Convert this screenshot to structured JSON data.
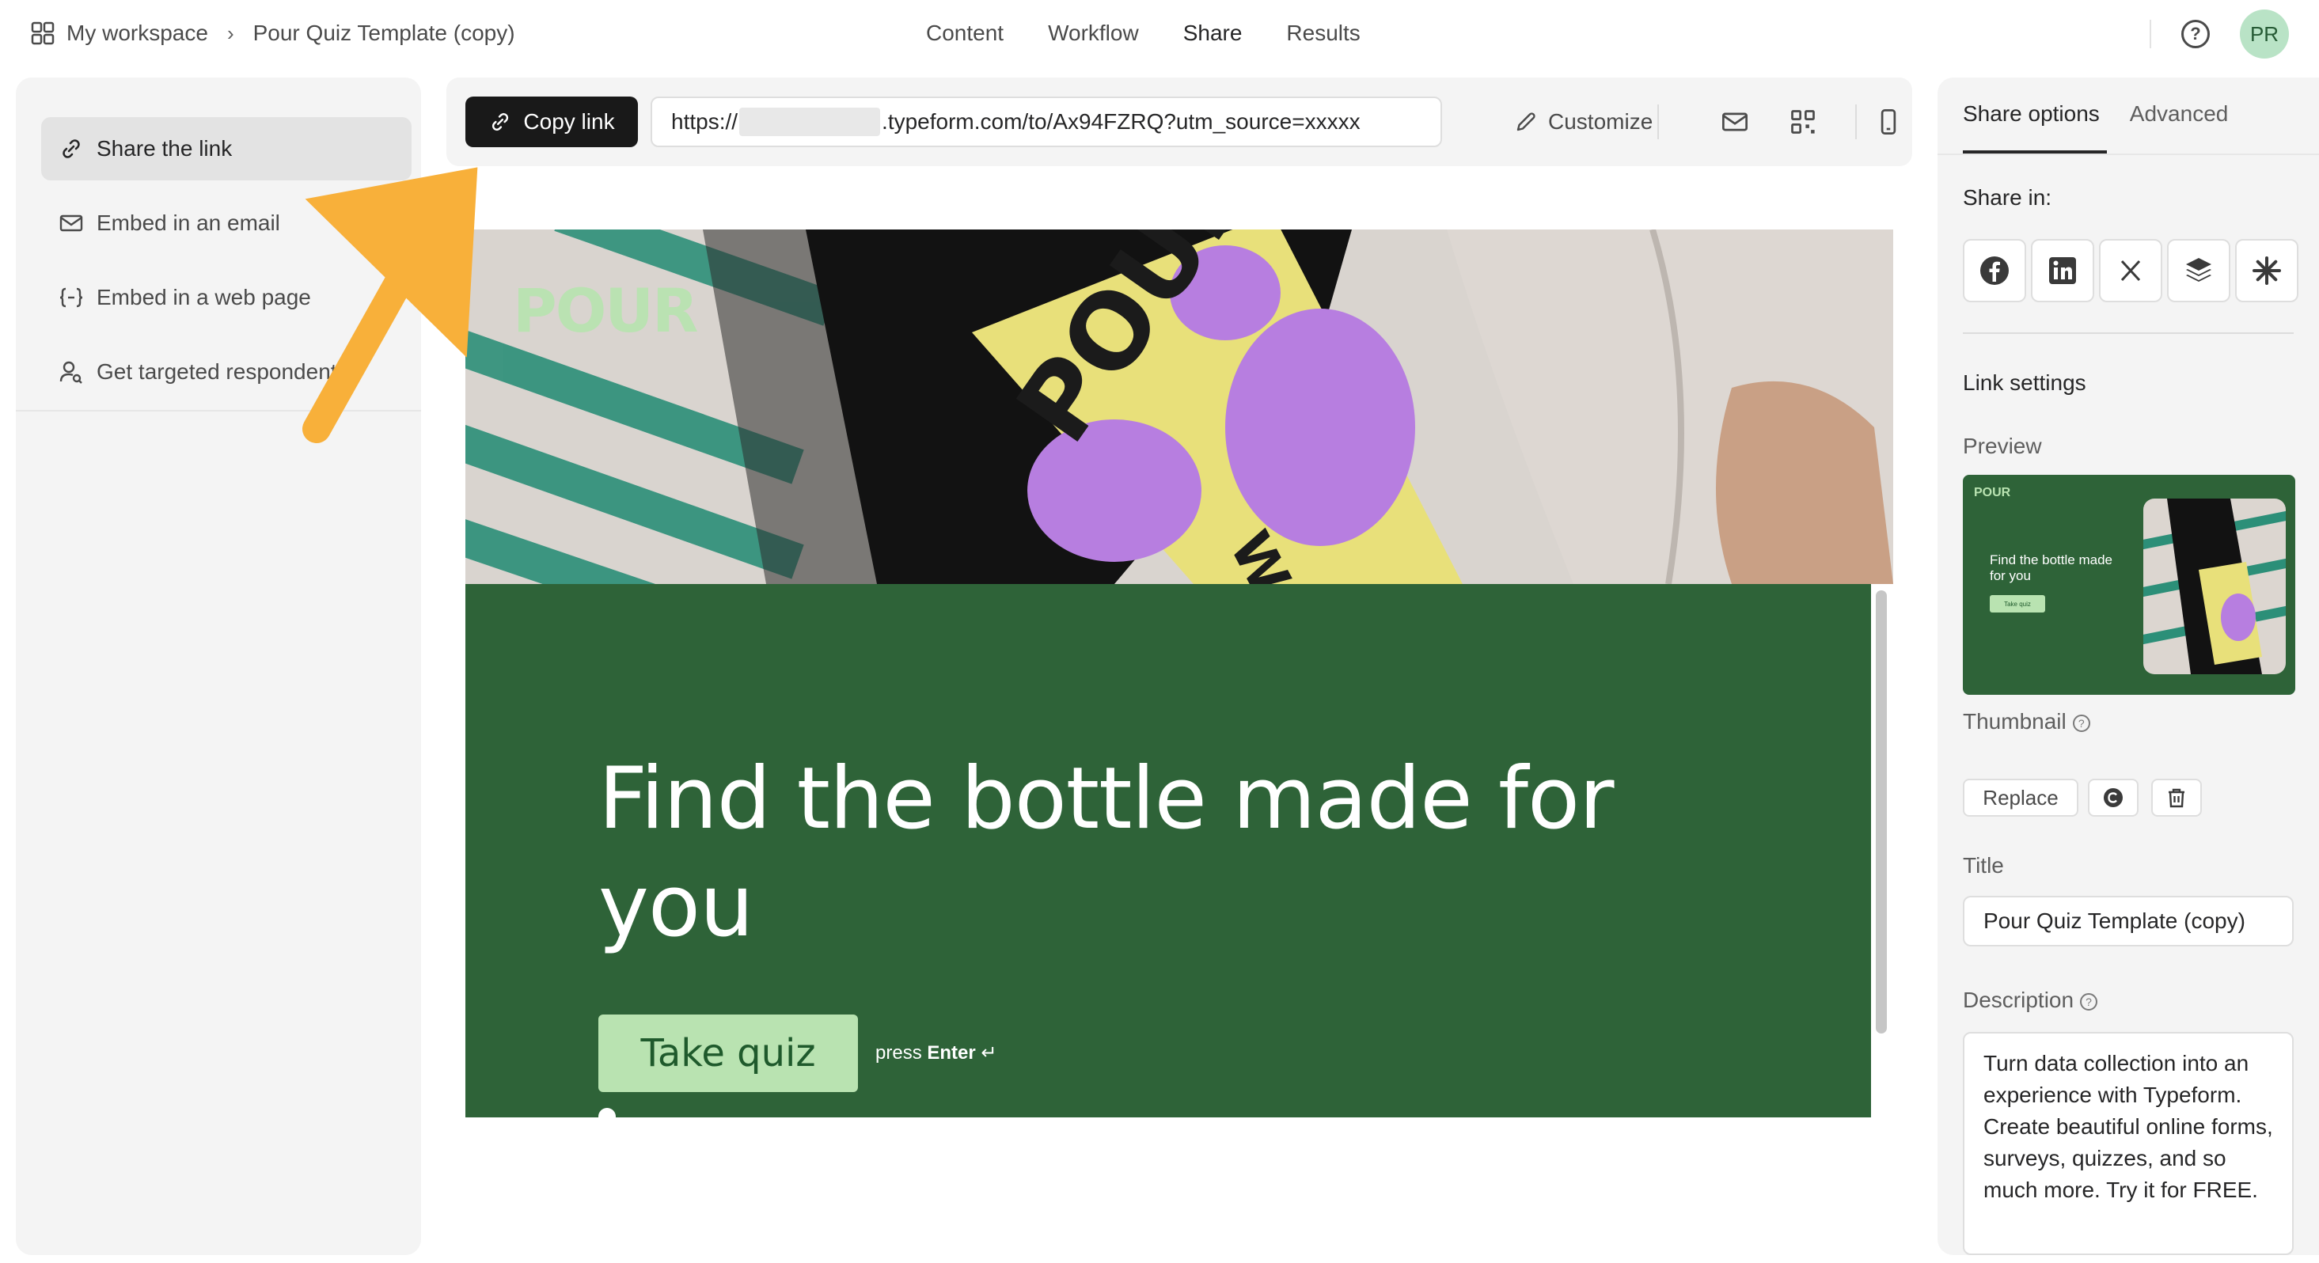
{
  "breadcrumb": {
    "workspace": "My workspace",
    "separator": "›",
    "form_name": "Pour Quiz Template (copy)"
  },
  "nav": {
    "tabs": [
      "Content",
      "Workflow",
      "Share",
      "Results"
    ],
    "active": "Share"
  },
  "user": {
    "initials": "PR"
  },
  "sidebar": {
    "items": [
      {
        "label": "Share the link",
        "icon": "link-icon",
        "active": true
      },
      {
        "label": "Embed in an email",
        "icon": "mail-icon",
        "active": false
      },
      {
        "label": "Embed in a web page",
        "icon": "embed-code-icon",
        "active": false
      },
      {
        "label": "Get targeted respondents",
        "icon": "person-search-icon",
        "active": false
      }
    ]
  },
  "toolbar": {
    "copy_label": "Copy link",
    "url_prefix": "https://",
    "url_suffix": ".typeform.com/to/Ax94FZRQ?utm_source=xxxxx",
    "customize_label": "Customize",
    "icons": [
      "mail-icon",
      "qr-code-icon",
      "mobile-icon"
    ]
  },
  "form_preview": {
    "logo": "POUR",
    "title": "Find the bottle made for you",
    "button_label": "Take quiz",
    "press": "press",
    "enter": "Enter",
    "enter_symbol": "↵",
    "colors": {
      "background": "#2e6338",
      "button": "#b9e3b1",
      "button_text": "#1f5a2c"
    }
  },
  "right_panel": {
    "tabs": [
      "Share options",
      "Advanced"
    ],
    "active_tab": "Share options",
    "share_in_label": "Share in:",
    "share_icons": [
      "facebook-icon",
      "linkedin-icon",
      "x-icon",
      "buffer-icon",
      "asterisk-icon"
    ],
    "link_settings_label": "Link settings",
    "preview_label": "Preview",
    "preview_card": {
      "logo": "POUR",
      "title": "Find the bottle made for you",
      "button": "Take quiz"
    },
    "thumbnail_label": "Thumbnail",
    "replace_label": "Replace",
    "title_label": "Title",
    "title_value": "Pour Quiz Template (copy)",
    "description_label": "Description",
    "description_value": "Turn data collection into an experience with Typeform. Create beautiful online forms, surveys, quizzes, and so much more. Try it for FREE."
  }
}
